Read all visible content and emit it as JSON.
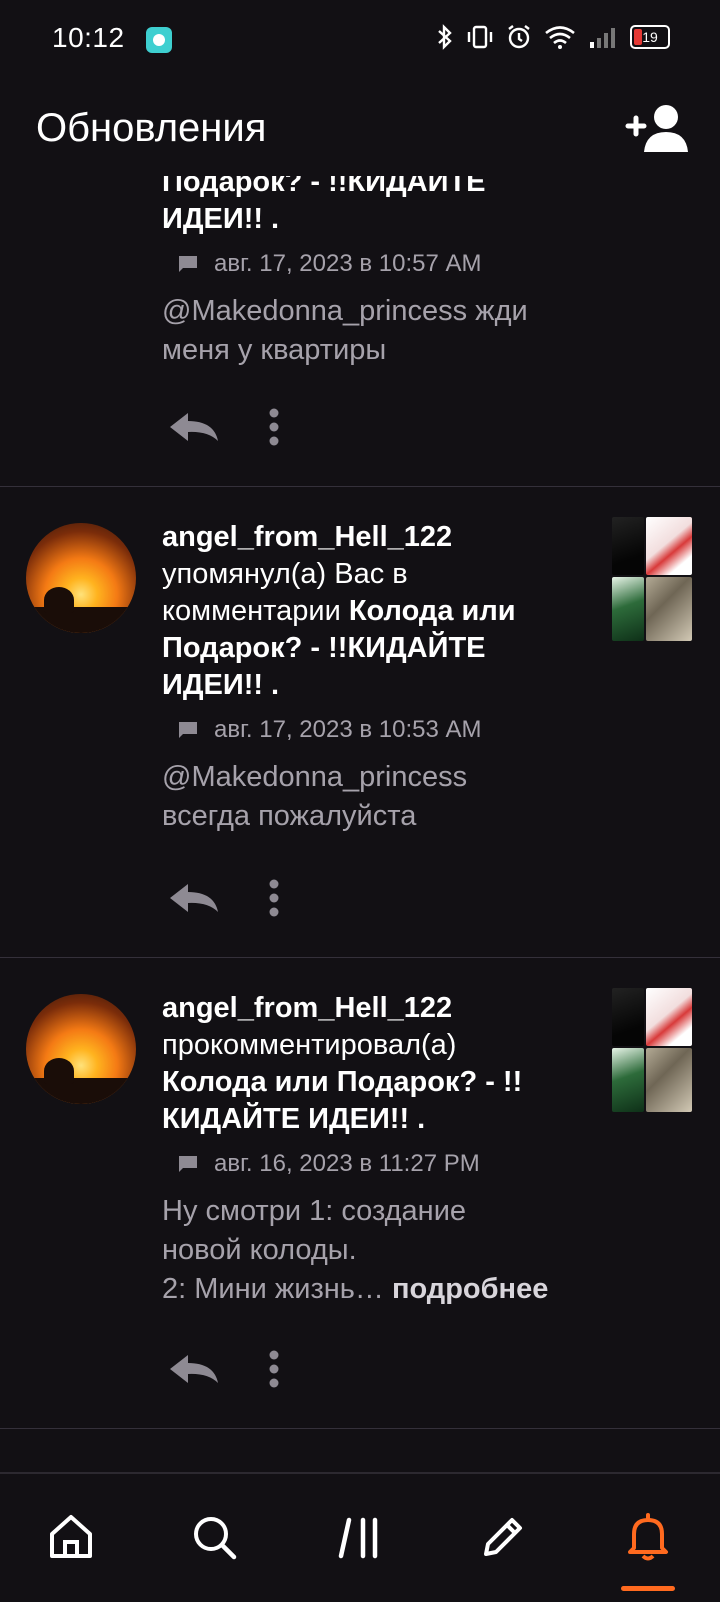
{
  "status_bar": {
    "time": "10:12",
    "battery": "19"
  },
  "header": {
    "title": "Обновления"
  },
  "feed": [
    {
      "title_lines": [
        "Подарок? - !!КИДАЙТЕ",
        "ИДЕИ!! ."
      ],
      "date": "авг. 17, 2023 в 10:57 AM",
      "excerpt_lines": [
        "@Makedonna_princess жди",
        "меня у квартиры"
      ]
    },
    {
      "user": "angel_from_Hell_122",
      "action": "упомянул(а) Вас в",
      "action2": "комментарии",
      "post_title_a": "Колода или",
      "post_title_b": "Подарок? - !!КИДАЙТЕ",
      "post_title_c": "ИДЕИ!! .",
      "date": "авг. 17, 2023 в 10:53 AM",
      "excerpt_lines": [
        "@Makedonna_princess",
        "всегда пожалуйста"
      ]
    },
    {
      "user": "angel_from_Hell_122",
      "action": "прокомментировал(а)",
      "post_title_a": "Колода или Подарок? - !!",
      "post_title_b": "КИДАЙТЕ ИДЕИ!! .",
      "date": "авг. 16, 2023 в 11:27 PM",
      "excerpt_lines": [
        "Ну смотри 1: создание",
        "новой колоды."
      ],
      "excerpt_last": "2: Мини жизнь…",
      "more_label": "подробнее"
    }
  ],
  "icons": {
    "add_user": "add-user-icon",
    "reply": "reply-icon",
    "more": "more-vertical-icon",
    "nav": [
      "home-icon",
      "search-icon",
      "feed-icon",
      "pencil-icon",
      "bell-icon"
    ]
  },
  "colors": {
    "background": "#121014",
    "accent": "#ff6a1f",
    "muted_text": "#a6a2ab"
  }
}
